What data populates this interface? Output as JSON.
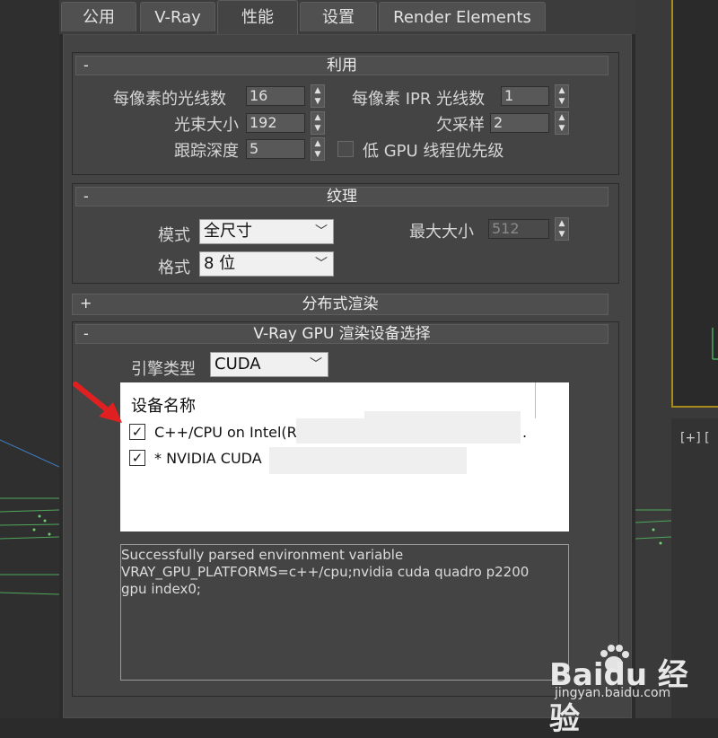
{
  "tabs": [
    "公用",
    "V-Ray",
    "性能",
    "设置",
    "Render Elements"
  ],
  "active_tab": "性能",
  "utilization": {
    "sign": "-",
    "title": "利用",
    "rays_per_pixel_label": "每像素的光线数",
    "rays_per_pixel": "16",
    "ipr_rays_per_pixel_label": "每像素 IPR 光线数",
    "ipr_rays_per_pixel": "1",
    "bundle_size_label": "光束大小",
    "bundle_size": "192",
    "undersampling_label": "欠采样",
    "undersampling": "2",
    "trace_depth_label": "跟踪深度",
    "trace_depth": "5",
    "low_gpu_priority_label": "低 GPU 线程优先级"
  },
  "textures": {
    "sign": "-",
    "title": "纹理",
    "mode_label": "模式",
    "mode_value": "全尺寸",
    "max_size_label": "最大大小",
    "max_size": "512",
    "format_label": "格式",
    "format_value": "8 位"
  },
  "distributed": {
    "sign": "+",
    "title": "分布式渲染"
  },
  "device_select": {
    "sign": "-",
    "title": "V-Ray GPU 渲染设备选择",
    "engine_label": "引擎类型",
    "engine_value": "CUDA",
    "device_header": "设备名称",
    "devices": [
      {
        "name": "C++/CPU on Intel(R",
        "suffix": ".",
        "checked": "✓"
      },
      {
        "name": "* NVIDIA CUDA",
        "suffix": "",
        "checked": "✓"
      }
    ],
    "log": [
      "Successfully parsed environment variable",
      "VRAY_GPU_PLATFORMS=c++/cpu;nvidia cuda quadro p2200",
      "gpu index0;"
    ]
  },
  "viewport": {
    "plus_label": "[+] ["
  },
  "watermark": {
    "brand": "Baidu 经验",
    "url": "jingyan.baidu.com"
  },
  "colors": {
    "panel": "#444444",
    "background": "#2b2b2b",
    "arrow": "#e02020",
    "viewport_border": "#a88a1a"
  },
  "icons": [
    "spinner-arrows-icon",
    "chevron-down-icon",
    "checkbox-icon",
    "red-arrow-icon",
    "baidu-paw-icon"
  ]
}
